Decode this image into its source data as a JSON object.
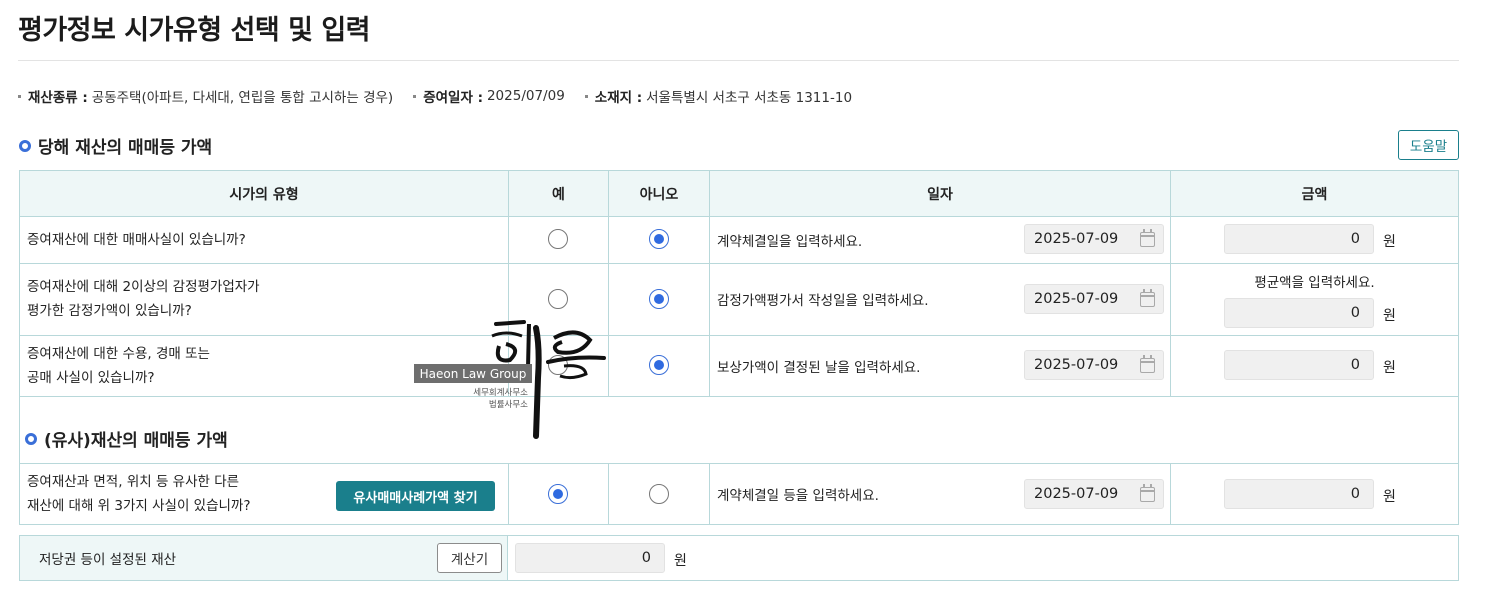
{
  "page": {
    "title": "평가정보 시가유형 선택 및 입력"
  },
  "info": {
    "asset_type_label": "재산종류 :",
    "asset_type_value": "공동주택(아파트, 다세대, 연립을 통합 고시하는 경우)",
    "gift_date_label": "증여일자 :",
    "gift_date_value": "2025/07/09",
    "location_label": "소재지 :",
    "location_value": "서울특별시 서초구 서초동 1311-10"
  },
  "section1": {
    "title": "당해 재산의 매매등 가액",
    "help_button": "도움말"
  },
  "table": {
    "headers": [
      "시가의 유형",
      "예",
      "아니오",
      "일자",
      "금액"
    ],
    "rows": [
      {
        "question_line1": "증여재산에 대한 매매사실이 있습니까?",
        "question_line2": "",
        "yes_selected": false,
        "no_selected": true,
        "date_prompt": "계약체결일을 입력하세요.",
        "date_value": "2025-07-09",
        "amount_note": "",
        "amount": "0",
        "unit": "원"
      },
      {
        "question_line1": "증여재산에 대해 2이상의 감정평가업자가",
        "question_line2": "평가한 감정가액이 있습니까?",
        "yes_selected": false,
        "no_selected": true,
        "date_prompt": "감정가액평가서 작성일을 입력하세요.",
        "date_value": "2025-07-09",
        "amount_note": "평균액을 입력하세요.",
        "amount": "0",
        "unit": "원"
      },
      {
        "question_line1": "증여재산에 대한 수용, 경매 또는",
        "question_line2": "공매 사실이 있습니까?",
        "yes_selected": false,
        "no_selected": true,
        "date_prompt": "보상가액이 결정된 날을 입력하세요.",
        "date_value": "2025-07-09",
        "amount_note": "",
        "amount": "0",
        "unit": "원"
      }
    ]
  },
  "section2": {
    "title": "(유사)재산의 매매등 가액",
    "question_line1": "증여재산과 면적, 위치 등 유사한 다른",
    "question_line2": "재산에 대해 위 3가지 사실이 있습니까?",
    "find_button": "유사매매사례가액 찾기",
    "yes_selected": true,
    "no_selected": false,
    "date_prompt": "계약체결일 등을 입력하세요.",
    "date_value": "2025-07-09",
    "amount": "0",
    "unit": "원"
  },
  "mortgage": {
    "label": "저당권 등이 설정된 재산",
    "calc_button": "계산기",
    "amount": "0",
    "unit": "원"
  },
  "watermark": {
    "brand": "Haeon Law Group",
    "sub1": "세무회계사무소",
    "sub2": "법률사무소"
  },
  "colors": {
    "accent_teal": "#1a7f8c",
    "radio_blue": "#2f6ae0",
    "header_bg": "#eef7f7",
    "border": "#b8d8da"
  }
}
